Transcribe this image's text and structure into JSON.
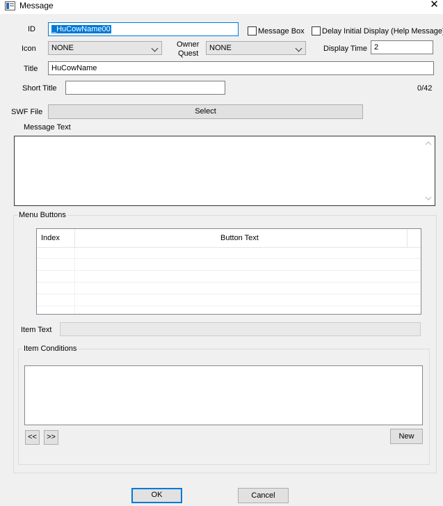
{
  "window": {
    "title": "Message",
    "close_glyph": "✕",
    "app_icon": "window-icon"
  },
  "fields": {
    "id_label": "ID",
    "id_value": "_HuCowName00",
    "message_box_label": "Message Box",
    "delay_label": "Delay Initial Display (Help Message)",
    "icon_label": "Icon",
    "icon_value": "NONE",
    "owner_quest_label_line1": "Owner",
    "owner_quest_label_line2": "Quest",
    "owner_quest_value": "NONE",
    "display_time_label": "Display Time",
    "display_time_value": "2",
    "title_label": "Title",
    "title_value": "HuCowName",
    "short_title_label": "Short Title",
    "short_title_value": "",
    "short_title_counter": "0/42",
    "swf_file_label": "SWF File",
    "swf_select_label": "Select",
    "message_text_label": "Message Text",
    "message_text_value": ""
  },
  "menu_buttons": {
    "group_label": "Menu Buttons",
    "columns": [
      "Index",
      "Button Text"
    ],
    "rows": [],
    "item_text_label": "Item Text",
    "item_text_value": ""
  },
  "conditions": {
    "group_label": "Item Conditions",
    "prev_label": "<<",
    "next_label": ">>",
    "new_label": "New"
  },
  "footer": {
    "ok_label": "OK",
    "cancel_label": "Cancel"
  },
  "colors": {
    "accent": "#0078d7",
    "background": "#f0f0f0"
  }
}
